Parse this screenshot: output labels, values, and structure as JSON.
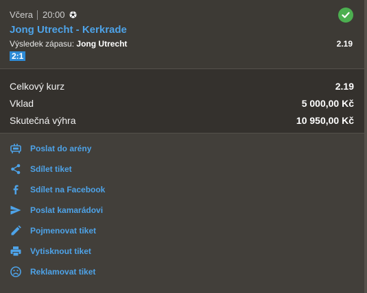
{
  "match": {
    "day": "Včera",
    "time": "20:00",
    "sport_icon": "soccer-ball-icon",
    "teams": "Jong Utrecht - Kerkrade",
    "market_label": "Výsledek zápasu:",
    "selection": "Jong Utrecht",
    "odds": "2.19",
    "score": "2:1",
    "status_icon": "check-circle-icon",
    "status_color": "#4caf50"
  },
  "summary": {
    "total_odds_label": "Celkový kurz",
    "total_odds": "2.19",
    "stake_label": "Vklad",
    "stake": "5 000,00 Kč",
    "win_label": "Skutečná výhra",
    "win": "10 950,00 Kč"
  },
  "actions": [
    {
      "label": "Poslat do arény",
      "icon": "arena-icon"
    },
    {
      "label": "Sdílet tiket",
      "icon": "share-icon"
    },
    {
      "label": "Sdílet na Facebook",
      "icon": "facebook-icon"
    },
    {
      "label": "Poslat kamarádovi",
      "icon": "send-icon"
    },
    {
      "label": "Pojmenovat tiket",
      "icon": "pencil-icon"
    },
    {
      "label": "Vytisknout tiket",
      "icon": "printer-icon"
    },
    {
      "label": "Reklamovat tiket",
      "icon": "sad-face-icon"
    }
  ],
  "colors": {
    "accent": "#4ea3e8",
    "success": "#4caf50",
    "background": "#423f3a"
  }
}
